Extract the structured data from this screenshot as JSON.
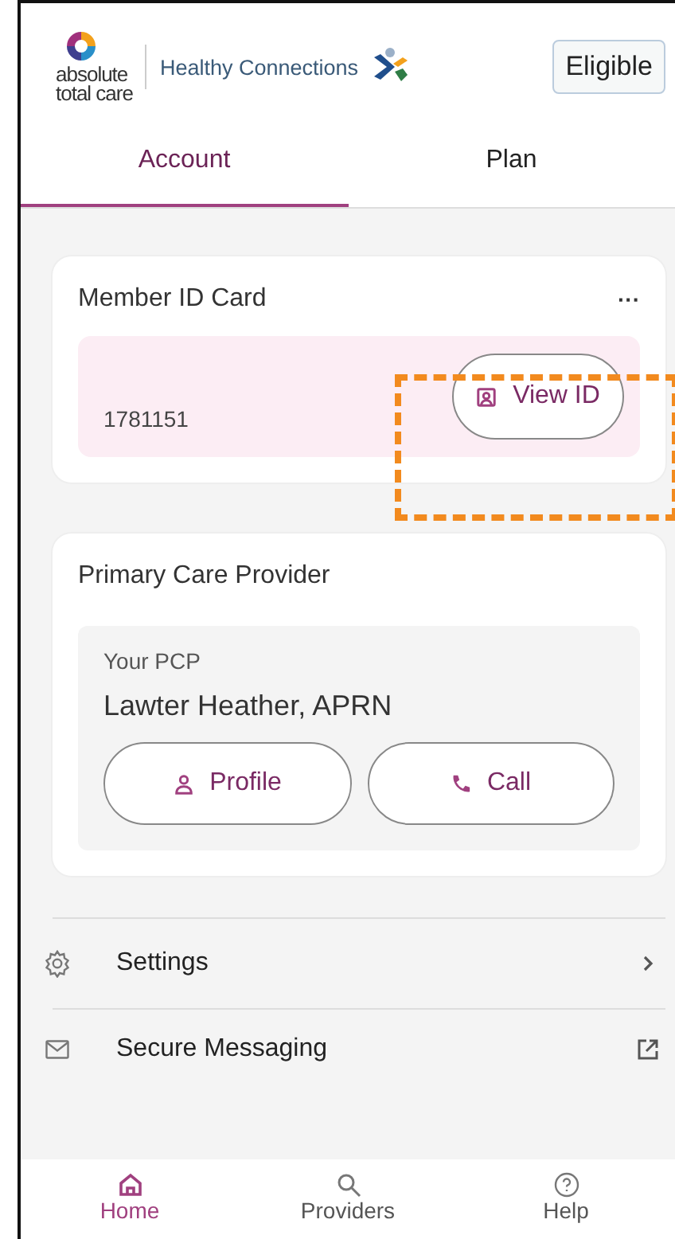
{
  "header": {
    "brand_line_1": "absolute",
    "brand_line_2": "total care",
    "program": "Healthy Connections",
    "status": "Eligible"
  },
  "tabs": [
    {
      "label": "Account",
      "selected": true
    },
    {
      "label": "Plan",
      "selected": false
    }
  ],
  "id_card": {
    "title": "Member ID Card",
    "more": "···",
    "member_id": "1781151",
    "button": "View ID",
    "highlighted": true
  },
  "pcp_card": {
    "title": "Primary Care Provider",
    "label": "Your PCP",
    "name": "Lawter Heather, APRN",
    "buttons": [
      {
        "label": "Profile",
        "kind": "profile"
      },
      {
        "label": "Call",
        "kind": "call"
      }
    ]
  },
  "menu": [
    {
      "label": "Settings",
      "kind": "settings"
    },
    {
      "label": "Secure Messaging",
      "kind": "messaging"
    }
  ],
  "nav": [
    {
      "label": "Home",
      "kind": "home",
      "selected": true
    },
    {
      "label": "Providers",
      "kind": "search",
      "selected": false
    },
    {
      "label": "Help",
      "kind": "help",
      "selected": false
    }
  ]
}
